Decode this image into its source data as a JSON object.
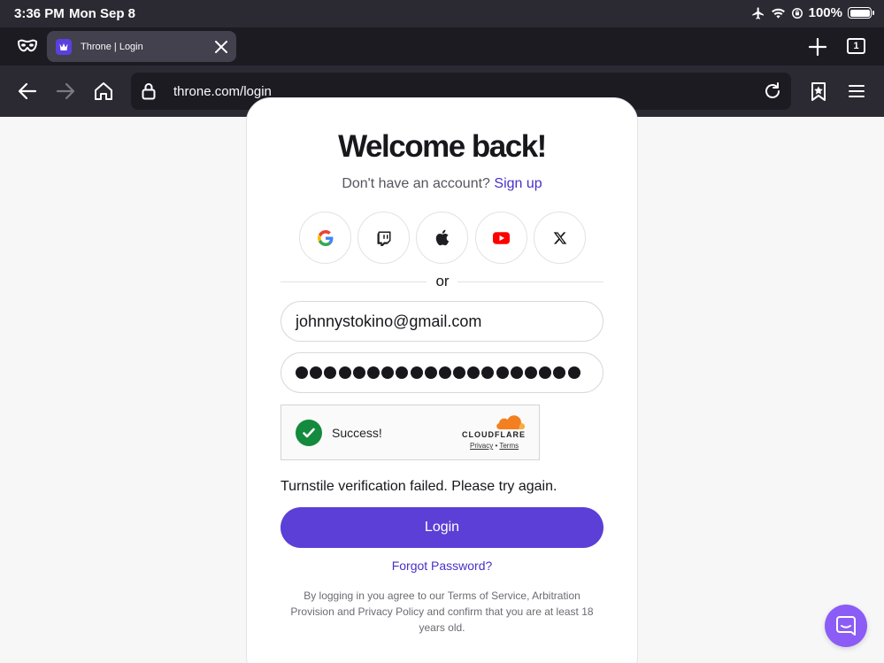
{
  "status_bar": {
    "time": "3:36 PM",
    "date": "Mon Sep 8",
    "battery": "100%",
    "icons": [
      "airplane-icon",
      "wifi-icon",
      "orientation-lock-icon",
      "battery-icon"
    ]
  },
  "browser": {
    "tab": {
      "title": "Throne | Login"
    },
    "tab_count": "1",
    "url": "throne.com/login"
  },
  "page": {
    "title": "Welcome back!",
    "signup_prompt": "Don't have an account?",
    "signup_link": "Sign up",
    "social_providers": [
      "google",
      "twitch",
      "apple",
      "youtube",
      "x"
    ],
    "divider_text": "or",
    "email_value": "johnnystokino@gmail.com",
    "password_mask_length": 20,
    "turnstile": {
      "status": "Success!",
      "brand": "CLOUDFLARE",
      "privacy": "Privacy",
      "separator": "•",
      "terms": "Terms"
    },
    "error_message": "Turnstile verification failed. Please try again.",
    "login_label": "Login",
    "forgot_label": "Forgot Password?",
    "legal_text": "By logging in you agree to our Terms of Service, Arbitration Provision and Privacy Policy and confirm that you are at least 18 years old."
  },
  "colors": {
    "accent": "#5b3fd6",
    "link": "#4a2fc9",
    "success": "#138a3d",
    "chrome_dark": "#2b2a33",
    "chat": "#8b5cf6"
  }
}
